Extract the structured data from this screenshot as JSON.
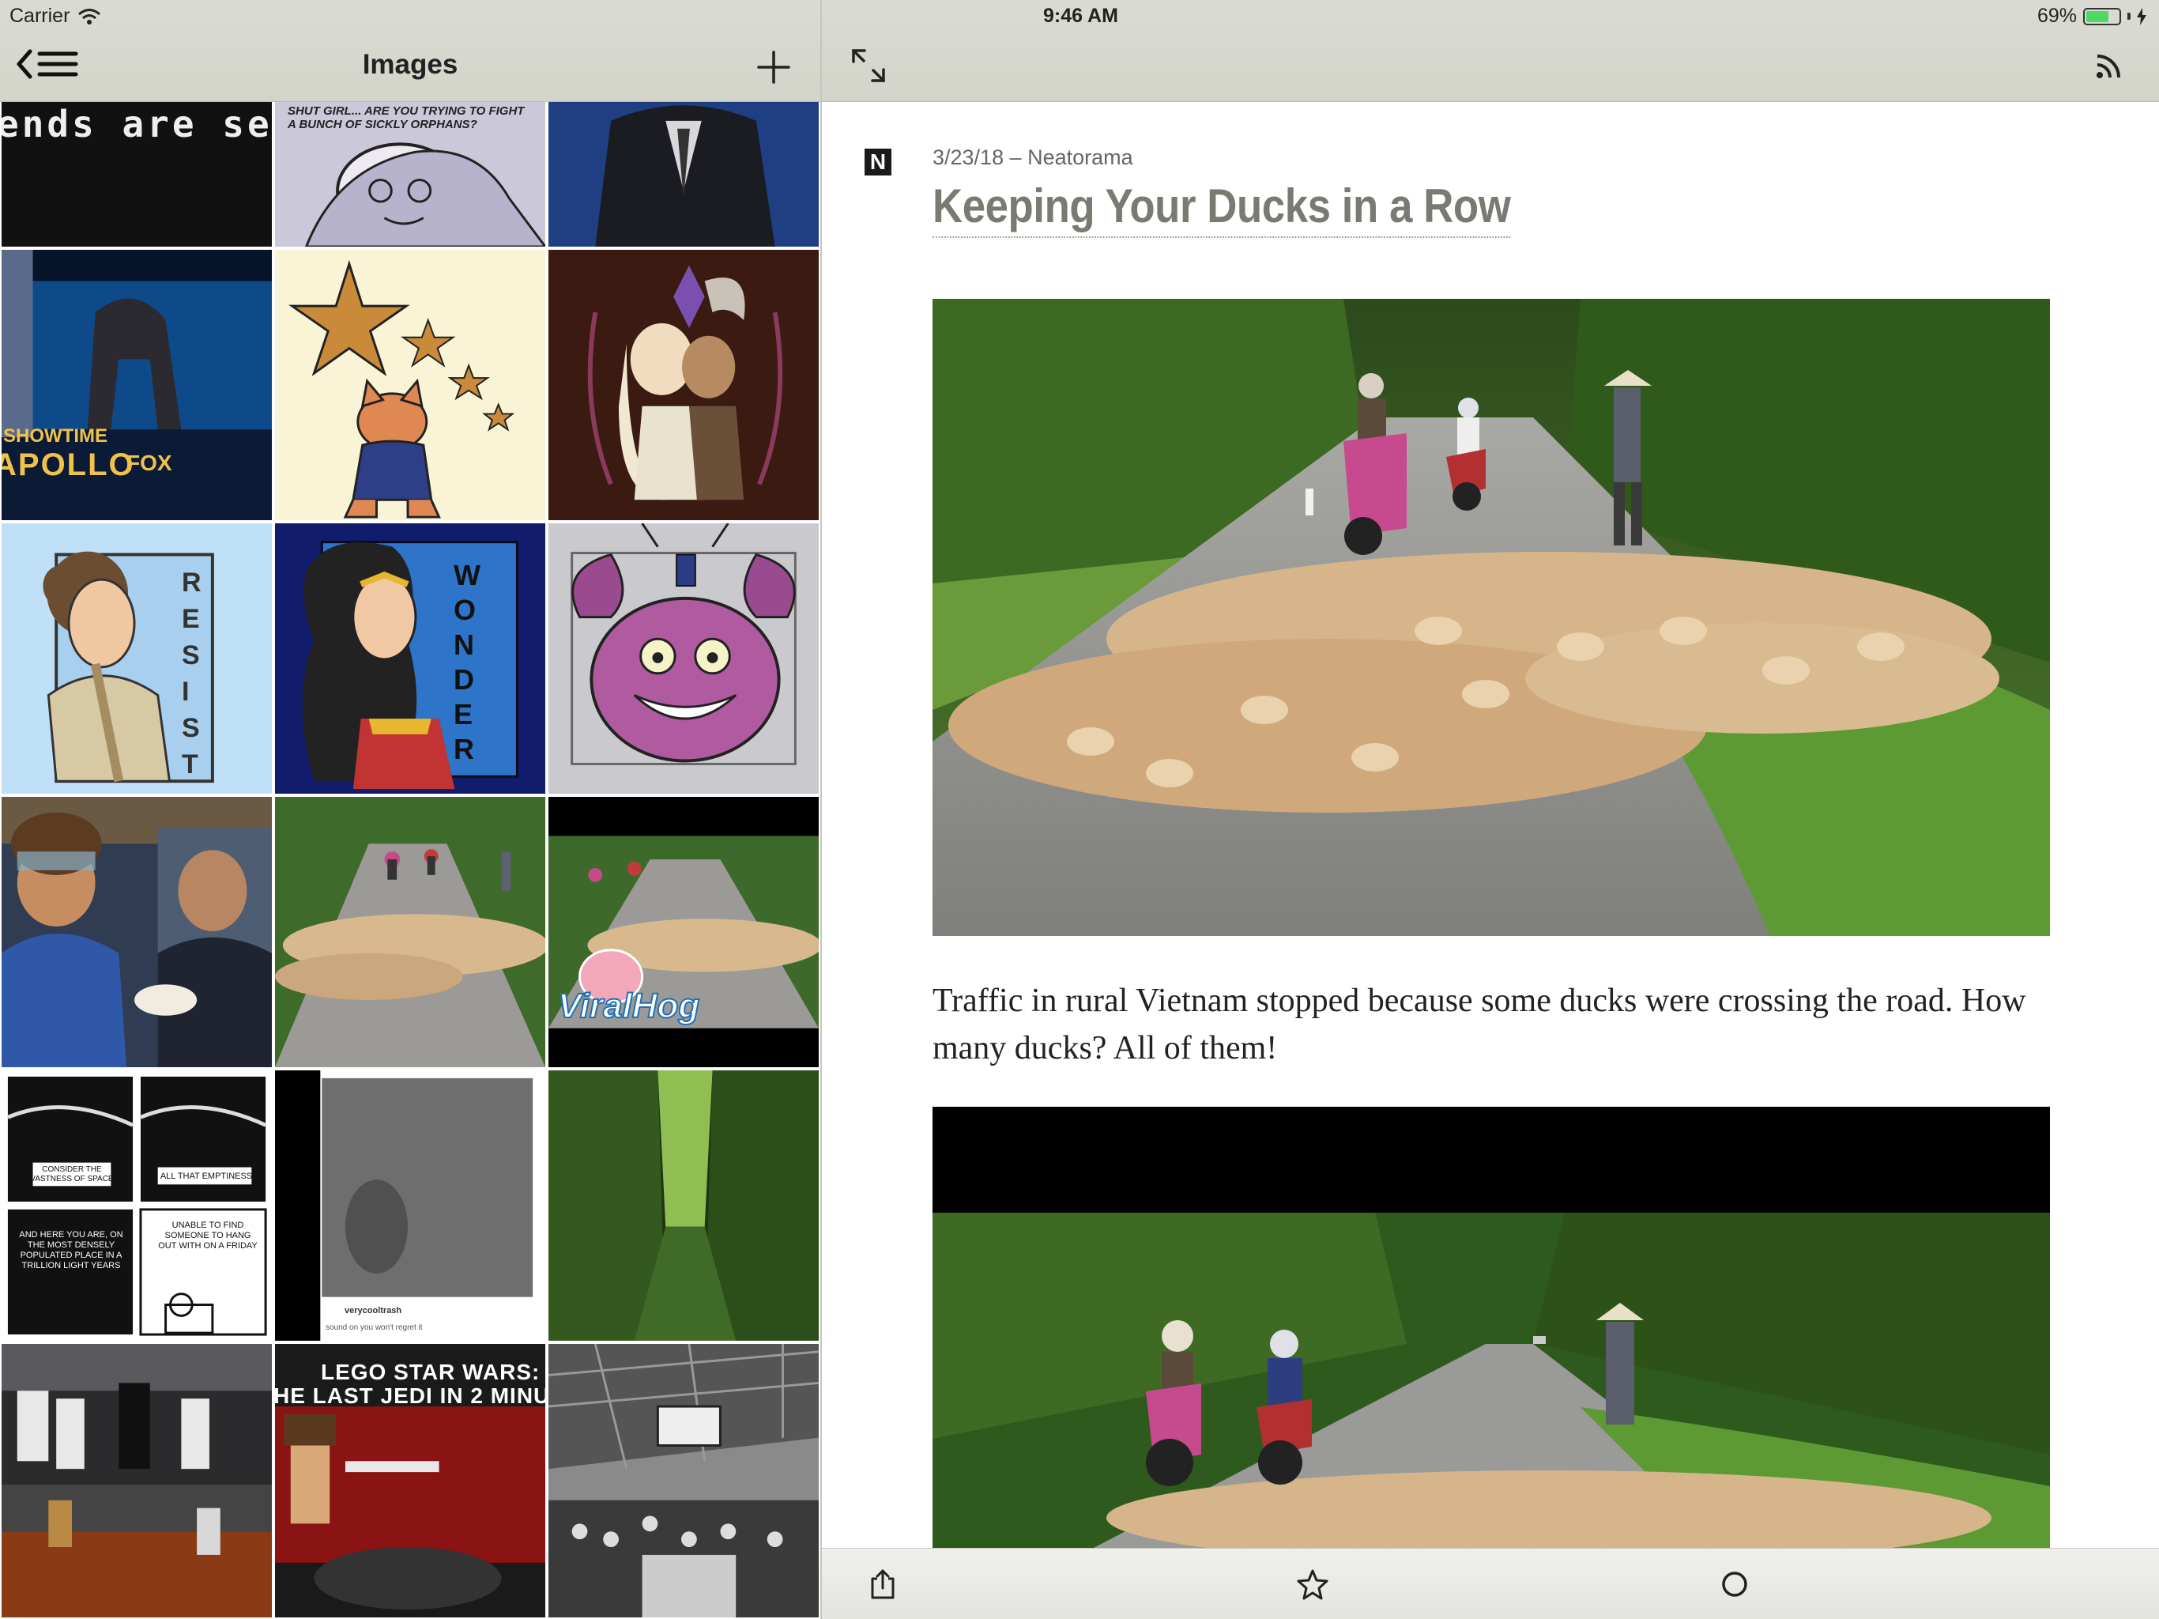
{
  "status_bar": {
    "carrier": "Carrier",
    "time": "9:46 AM",
    "battery_percent": "69%",
    "battery_level": 0.69,
    "battery_color": "#4cd964"
  },
  "left_panel": {
    "title": "Images",
    "back_icon": "back-list-icon",
    "add_icon": "plus-icon",
    "tiles": [
      {
        "caption": "ends are se"
      },
      {
        "caption": "SHUT GIRL... ARE YOU TRYING TO FIGHT A BUNCH OF SICKLY ORPHANS?"
      },
      {
        "caption": ""
      },
      {
        "caption": "SHOWTIME",
        "caption2": "APOLLO",
        "caption3": "FOX"
      },
      {
        "caption": ""
      },
      {
        "caption": ""
      },
      {
        "caption": "RESIST"
      },
      {
        "caption": "WONDER"
      },
      {
        "caption": ""
      },
      {
        "caption": ""
      },
      {
        "caption": ""
      },
      {
        "caption": "ViralHog"
      },
      {
        "caption": "CONSIDER THE VASTNESS OF SPACE",
        "caption2": "ALL THAT EMPTINESS",
        "caption3": "AND HERE YOU ARE, ON THE MOST DENSELY POPULATED PLACE IN A TRILLION LIGHT YEARS",
        "caption4": "UNABLE TO FIND SOMEONE TO HANG OUT WITH ON A FRIDAY"
      },
      {
        "caption": "verycooltrash",
        "caption2": "sound on you won't regret it"
      },
      {
        "caption": ""
      },
      {
        "caption": ""
      },
      {
        "caption": "LEGO STAR WARS:",
        "caption2": "HE LAST JEDI IN 2 MINU"
      },
      {
        "caption": ""
      }
    ]
  },
  "article": {
    "feed_badge": "N",
    "meta": "3/23/18 – Neatorama",
    "title": "Keeping Your Ducks in a Row",
    "body": "Traffic in rural Vietnam stopped because some ducks were crossing the road. How many ducks? All of them!"
  },
  "toolbar": {
    "expand_icon": "expand-icon",
    "rss_icon": "rss-icon",
    "share_icon": "share-icon",
    "star_icon": "star-icon",
    "circle_icon": "mark-read-circle-icon"
  }
}
